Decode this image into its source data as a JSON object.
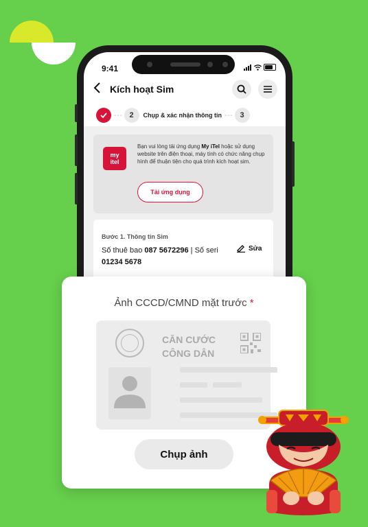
{
  "status_bar": {
    "time": "9:41"
  },
  "header": {
    "title": "Kích hoạt Sim"
  },
  "stepper": {
    "step2_number": "2",
    "step2_label": "Chụp & xác nhận thông tin",
    "step3_number": "3"
  },
  "promo": {
    "logo_line1": "my",
    "logo_line2": "itel",
    "text_before": "Bạn vui lòng tải ứng dụng ",
    "text_app": "My iTel",
    "text_after": " hoặc sử dụng website trên điện thoại, máy tính có chức năng chụp hình để thuận tiện cho quá trình kích hoạt sim.",
    "download_label": "Tải ứng dụng"
  },
  "sim": {
    "step_label": "Bước 1. Thông tin Sim",
    "phone_prefix": "Số thuê bao ",
    "phone_number": "087 5672296",
    "serial_prefix": " | Số seri ",
    "serial_number": "01234 5678",
    "edit_label": "Sửa"
  },
  "id_capture": {
    "title": "Ảnh CCCD/CMND mặt trước",
    "required_mark": "*",
    "card_heading_line1": "CĂN CƯỚC",
    "card_heading_line2": "CÔNG DÂN",
    "capture_label": "Chụp ảnh"
  },
  "colors": {
    "background": "#66cf4b",
    "brand_red": "#d6143a",
    "accent_yellow": "#d8e82a"
  }
}
